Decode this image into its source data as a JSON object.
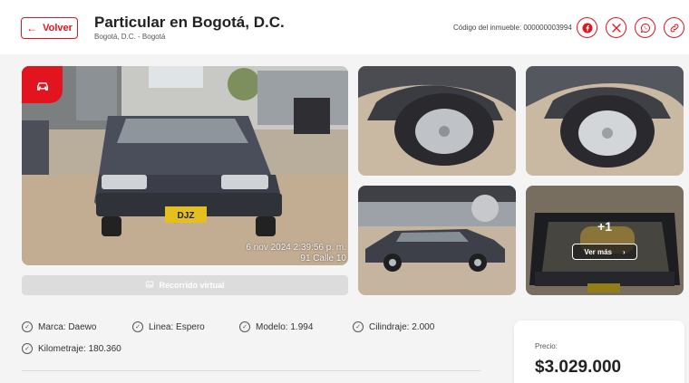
{
  "header": {
    "back_label": "Volver",
    "title": "Particular en Bogotá, D.C.",
    "breadcrumb": "Bogotá, D.C. - Bogotá",
    "property_code": "Código del inmueble: 000000003994",
    "share_icons": [
      "facebook-icon",
      "x-twitter-icon",
      "whatsapp-icon",
      "link-icon"
    ]
  },
  "gallery": {
    "photo_stamp_date": "6 nov 2024 2:39:56 p. m.",
    "photo_stamp_address": "91 Calle 10",
    "more_count": "+1",
    "see_more_label": "Ver más",
    "virtual_tour_label": "Recorrido virtual",
    "plate_text": "DJZ"
  },
  "specs": [
    {
      "text": "Marca: Daewo"
    },
    {
      "text": "Linea: Espero"
    },
    {
      "text": "Modelo: 1.994"
    },
    {
      "text": "Cilindraje: 2.000"
    },
    {
      "text": "Kilometraje: 180.360"
    }
  ],
  "price": {
    "label": "Precio:",
    "value": "$3.029.000"
  },
  "colors": {
    "accent": "#e2141f",
    "background": "#f4f4f4",
    "card": "#ffffff"
  }
}
